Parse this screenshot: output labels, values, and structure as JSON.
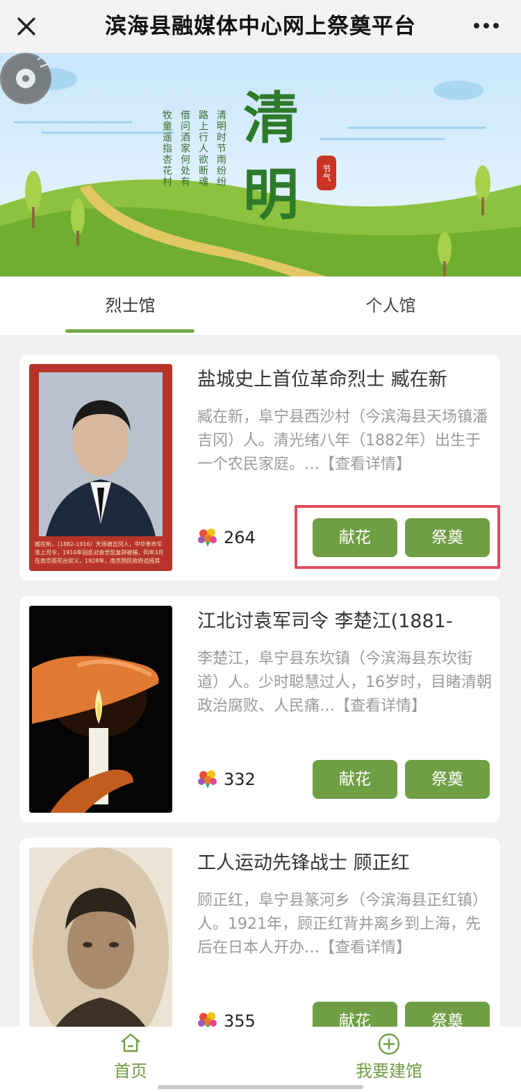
{
  "header": {
    "title": "滨海县融媒体中心网上祭奠平台",
    "close_icon": "close-icon",
    "more_icon": "more-icon"
  },
  "banner": {
    "big_char_1": "清",
    "big_char_2": "明",
    "seal_text": "节气",
    "poem": [
      "清明时节雨纷纷",
      "路上行人欲断魂",
      "借问酒家何处有",
      "牧童遥指杏花村"
    ],
    "music_icon": "music-disc-icon"
  },
  "tabs": [
    {
      "label": "烈士馆",
      "active": true
    },
    {
      "label": "个人馆",
      "active": false
    }
  ],
  "cards": [
    {
      "name": "盐城史上首位革命烈士 臧在新",
      "desc": "臧在新，阜宁县西沙村（今滨海县天场镇潘吉冈）人。清光绪八年（1882年）出生于一个农民家庭。…【查看详情】",
      "count": "264",
      "photo_caption": "臧在新，（1882-1916）天场镇吉冈人，中华革命军淮上司令，1916年因反对袁世凯复辟被捕，同年3月在南京雨花台就义，1928年，南京国民政府追授其",
      "btn_flower": "献花",
      "btn_memorial": "祭奠"
    },
    {
      "name": "江北讨袁军司令 李楚江(1881-",
      "desc": "李楚江，阜宁县东坎镇（今滨海县东坎街道）人。少时聪慧过人，16岁时，目睹清朝政治腐败、人民痛…【查看详情】",
      "count": "332",
      "btn_flower": "献花",
      "btn_memorial": "祭奠"
    },
    {
      "name": "工人运动先锋战士 顾正红",
      "desc": "顾正红，阜宁县篆河乡（今滨海县正红镇）人。1921年，顾正红背井离乡到上海，先后在日本人开办…【查看详情】",
      "count": "355",
      "btn_flower": "献花",
      "btn_memorial": "祭奠"
    }
  ],
  "bottom_nav": [
    {
      "label": "首页",
      "icon": "home-icon"
    },
    {
      "label": "我要建馆",
      "icon": "plus-circle-icon"
    }
  ],
  "colors": {
    "accent": "#6f9e43",
    "highlight": "#e14b5f",
    "background": "#f1f1f1"
  }
}
